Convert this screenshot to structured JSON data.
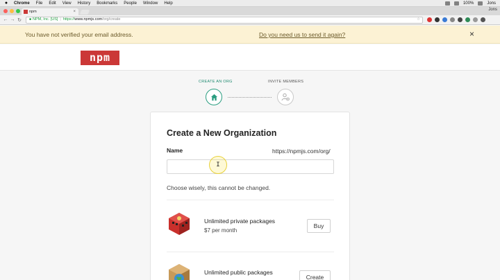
{
  "menubar": {
    "items": [
      "Chrome",
      "File",
      "Edit",
      "View",
      "History",
      "Bookmarks",
      "People",
      "Window",
      "Help"
    ],
    "battery": "100%",
    "user": "Jons"
  },
  "browser": {
    "tab_title": "npm",
    "profile": "Jons",
    "security_label": "NPM, Inc. [US]",
    "url_scheme": "https://",
    "url_host": "www.npmjs.com",
    "url_path": "/org/create"
  },
  "banner": {
    "message": "You have not verified your email address.",
    "link": "Do you need us to send it again?",
    "close": "×"
  },
  "header": {
    "logo_text": "npm",
    "brand_color": "#cb3837"
  },
  "steps": [
    {
      "label": "CREATE AN ORG",
      "state": "active",
      "icon": "home-icon"
    },
    {
      "label": "INVITE MEMBERS",
      "state": "inactive",
      "icon": "add-user-icon"
    }
  ],
  "form": {
    "title": "Create a New Organization",
    "name_label": "Name",
    "url_prefix": "https://npmjs.com/org/",
    "name_value": "",
    "cursor_glyph": "I",
    "hint": "Choose wisely, this cannot be changed."
  },
  "plans": [
    {
      "title": "Unlimited private packages",
      "price": "$7 per month",
      "button": "Buy",
      "icon": "private-package-icon"
    },
    {
      "title": "Unlimited public packages",
      "price": "",
      "button": "Create",
      "icon": "public-package-icon"
    }
  ],
  "colors": {
    "accent": "#2a9d80",
    "banner_bg": "#fcf2d4"
  }
}
